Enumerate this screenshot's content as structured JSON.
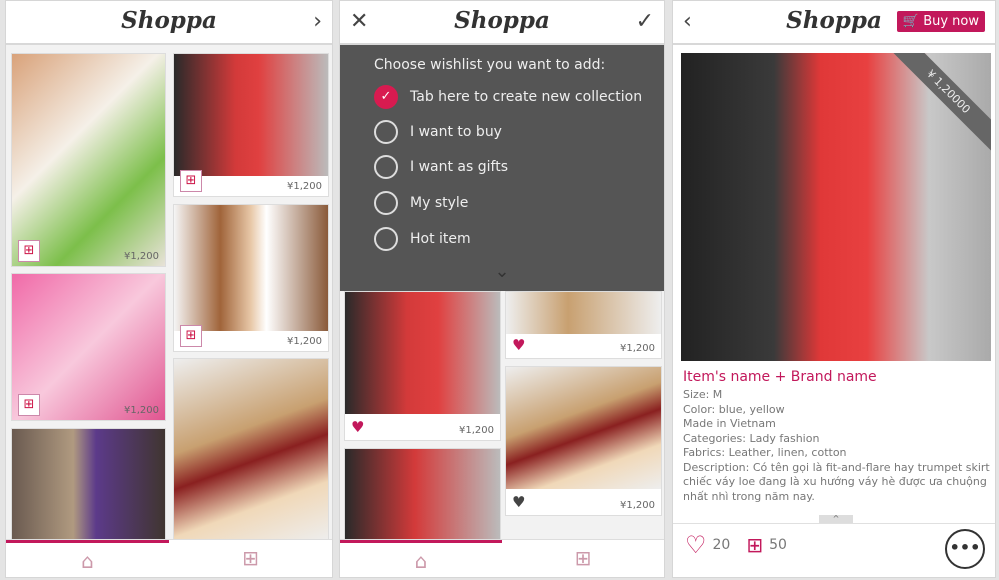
{
  "app": {
    "title": "Shoppa"
  },
  "screen1": {
    "header_icon": "chevron-right-icon",
    "tiles": [
      {
        "price": "¥1,200"
      },
      {
        "price": "¥1,200"
      },
      {
        "price": "¥1,200"
      },
      {
        "price": "¥1,200"
      }
    ],
    "nav": {
      "home": "home-icon",
      "wishlist": "bookmark-add-icon"
    }
  },
  "screen2": {
    "close_icon": "close-icon",
    "confirm_icon": "checkmark-icon",
    "wishlist": {
      "title": "Choose wishlist you want to add:",
      "options": [
        {
          "label": "Tab here to create new collection",
          "checked": true
        },
        {
          "label": "I want to buy",
          "checked": false
        },
        {
          "label": "I want as gifts",
          "checked": false
        },
        {
          "label": "My style",
          "checked": false
        },
        {
          "label": "Hot item",
          "checked": false
        }
      ]
    },
    "tiles": [
      {
        "price": "¥1,200"
      },
      {
        "price": "¥1,200"
      },
      {
        "price": "¥1,200"
      }
    ]
  },
  "screen3": {
    "back_icon": "chevron-left-icon",
    "buy_now": "Buy now",
    "price_ribbon": "¥ 1,20000",
    "item": {
      "name": "Item's name + Brand name",
      "lines": [
        "Size: M",
        "Color: blue, yellow",
        "Made in Vietnam",
        "Categories: Lady fashion",
        "Fabrics: Leather, linen, cotton",
        "Description: Có tên gọi là fit-and-flare hay trumpet skirt chiếc váy loe đang là xu hướng váy hè được ưa chuộng nhất nhì trong năm nay."
      ]
    },
    "likes": "20",
    "saves": "50"
  },
  "colors": {
    "accent": "#c2185b",
    "overlay": "#555555"
  }
}
